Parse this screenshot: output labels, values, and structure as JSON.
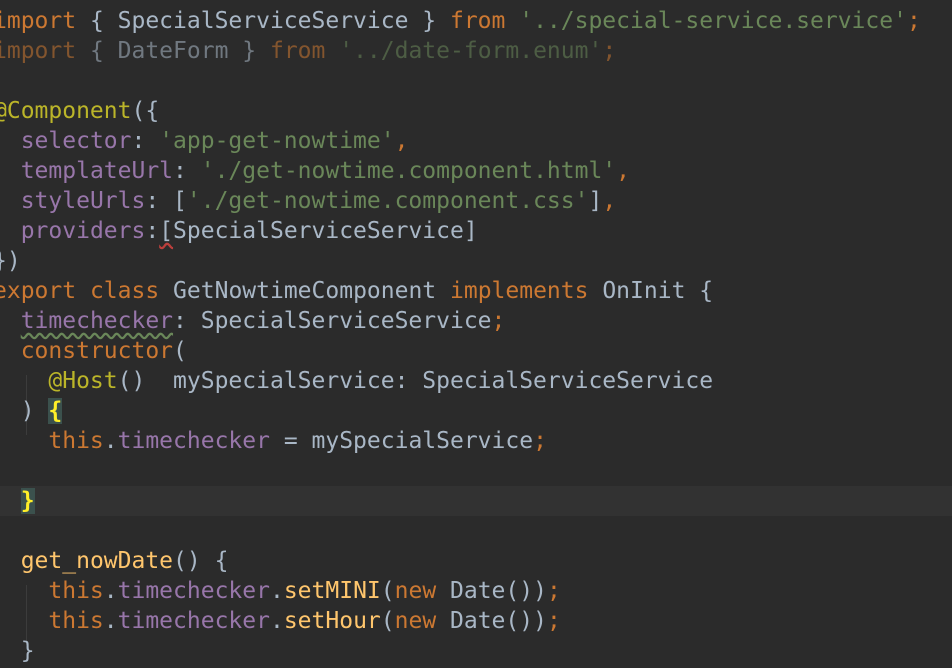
{
  "editor": {
    "lines": [
      {
        "tokens": [
          {
            "t": "import",
            "c": "kw"
          },
          {
            "t": " { SpecialServiceService } ",
            "c": ""
          },
          {
            "t": "from",
            "c": "kw"
          },
          {
            "t": " ",
            "c": ""
          },
          {
            "t": "'../special-service.service'",
            "c": "str"
          },
          {
            "t": ";",
            "c": "kw"
          }
        ]
      },
      {
        "dim": true,
        "tokens": [
          {
            "t": "import",
            "c": "kw"
          },
          {
            "t": " { DateForm } ",
            "c": ""
          },
          {
            "t": "from",
            "c": "kw"
          },
          {
            "t": " ",
            "c": ""
          },
          {
            "t": "'../date-form.enum'",
            "c": "str"
          },
          {
            "t": ";",
            "c": "kw"
          }
        ]
      },
      {
        "tokens": []
      },
      {
        "tokens": [
          {
            "t": "@Component",
            "c": "ann"
          },
          {
            "t": "({",
            "c": ""
          }
        ]
      },
      {
        "tokens": [
          {
            "t": "  ",
            "c": ""
          },
          {
            "t": "selector",
            "c": "prop"
          },
          {
            "t": ": ",
            "c": ""
          },
          {
            "t": "'app-get-nowtime'",
            "c": "str"
          },
          {
            "t": ",",
            "c": "kw"
          }
        ]
      },
      {
        "tokens": [
          {
            "t": "  ",
            "c": ""
          },
          {
            "t": "templateUrl",
            "c": "prop"
          },
          {
            "t": ": ",
            "c": ""
          },
          {
            "t": "'./get-nowtime.component.html'",
            "c": "str"
          },
          {
            "t": ",",
            "c": "kw"
          }
        ]
      },
      {
        "tokens": [
          {
            "t": "  ",
            "c": ""
          },
          {
            "t": "styleUrls",
            "c": "prop"
          },
          {
            "t": ": [",
            "c": ""
          },
          {
            "t": "'./get-nowtime.component.css'",
            "c": "str"
          },
          {
            "t": "]",
            "c": ""
          },
          {
            "t": ",",
            "c": "kw"
          }
        ]
      },
      {
        "tokens": [
          {
            "t": "  ",
            "c": ""
          },
          {
            "t": "providers",
            "c": "prop"
          },
          {
            "t": ":",
            "c": ""
          },
          {
            "t": "[",
            "c": "red-wavy"
          },
          {
            "t": "SpecialServiceService]",
            "c": ""
          }
        ]
      },
      {
        "tokens": [
          {
            "t": "})",
            "c": ""
          }
        ]
      },
      {
        "tokens": [
          {
            "t": "export",
            "c": "kw"
          },
          {
            "t": " ",
            "c": ""
          },
          {
            "t": "class",
            "c": "kw"
          },
          {
            "t": " GetNowtimeComponent ",
            "c": ""
          },
          {
            "t": "implements",
            "c": "kw"
          },
          {
            "t": " OnInit {",
            "c": ""
          }
        ]
      },
      {
        "tokens": [
          {
            "t": "  ",
            "c": ""
          },
          {
            "t": "timechecker",
            "c": "prop wavy"
          },
          {
            "t": ": SpecialServiceService",
            "c": ""
          },
          {
            "t": ";",
            "c": "kw"
          }
        ]
      },
      {
        "tokens": [
          {
            "t": "  ",
            "c": ""
          },
          {
            "t": "constructor",
            "c": "kw"
          },
          {
            "t": "(",
            "c": ""
          }
        ]
      },
      {
        "tokens": [
          {
            "t": "    ",
            "c": ""
          },
          {
            "t": "@Host",
            "c": "ann"
          },
          {
            "t": "()  mySpecialService: SpecialServiceService",
            "c": ""
          }
        ]
      },
      {
        "tokens": [
          {
            "t": "  ) ",
            "c": ""
          },
          {
            "t": "{",
            "c": "brace-match"
          }
        ]
      },
      {
        "tokens": [
          {
            "t": "    ",
            "c": ""
          },
          {
            "t": "this",
            "c": "kw"
          },
          {
            "t": ".",
            "c": ""
          },
          {
            "t": "timechecker",
            "c": "prop"
          },
          {
            "t": " = mySpecialService",
            "c": ""
          },
          {
            "t": ";",
            "c": "kw"
          }
        ]
      },
      {
        "tokens": []
      },
      {
        "current": true,
        "tokens": [
          {
            "t": "  ",
            "c": ""
          },
          {
            "t": "}",
            "c": "brace-match"
          }
        ]
      },
      {
        "tokens": []
      },
      {
        "tokens": [
          {
            "t": "  ",
            "c": ""
          },
          {
            "t": "get_nowDate",
            "c": "fn"
          },
          {
            "t": "() {",
            "c": ""
          }
        ]
      },
      {
        "tokens": [
          {
            "t": "    ",
            "c": ""
          },
          {
            "t": "this",
            "c": "kw"
          },
          {
            "t": ".",
            "c": ""
          },
          {
            "t": "timechecker",
            "c": "prop"
          },
          {
            "t": ".",
            "c": ""
          },
          {
            "t": "setMINI",
            "c": "fn"
          },
          {
            "t": "(",
            "c": ""
          },
          {
            "t": "new",
            "c": "kw"
          },
          {
            "t": " Date())",
            "c": ""
          },
          {
            "t": ";",
            "c": "kw"
          }
        ]
      },
      {
        "tokens": [
          {
            "t": "    ",
            "c": ""
          },
          {
            "t": "this",
            "c": "kw"
          },
          {
            "t": ".",
            "c": ""
          },
          {
            "t": "timechecker",
            "c": "prop"
          },
          {
            "t": ".",
            "c": ""
          },
          {
            "t": "setHour",
            "c": "fn"
          },
          {
            "t": "(",
            "c": ""
          },
          {
            "t": "new",
            "c": "kw"
          },
          {
            "t": " Date())",
            "c": ""
          },
          {
            "t": ";",
            "c": "kw"
          }
        ]
      },
      {
        "tokens": [
          {
            "t": "  }",
            "c": ""
          }
        ]
      }
    ]
  },
  "colors": {
    "background": "#2b2b2b",
    "current_line": "#323232",
    "text": "#a9b7c6",
    "keyword": "#cc7832",
    "string": "#6a8759",
    "property": "#9876aa",
    "function": "#ffc66d",
    "annotation": "#bbb529"
  }
}
